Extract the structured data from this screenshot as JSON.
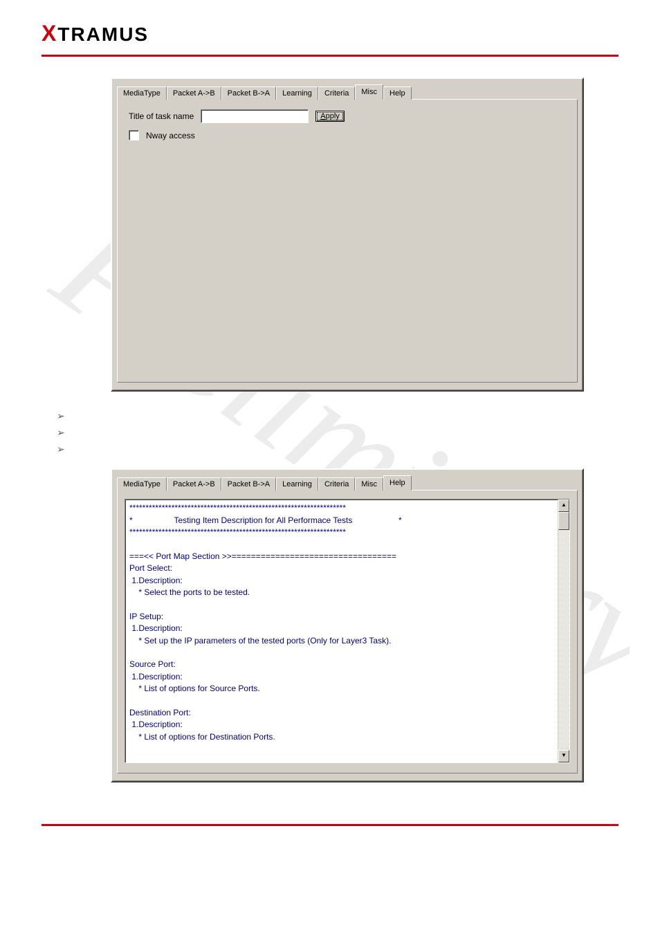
{
  "brand": {
    "prefix": "X",
    "rest": "TRAMUS"
  },
  "tabstrip": {
    "tabs": [
      {
        "label": "MediaType"
      },
      {
        "label": "Packet A->B"
      },
      {
        "label": "Packet B->A"
      },
      {
        "label": "Learning"
      },
      {
        "label": "Criteria"
      },
      {
        "label": "Misc"
      },
      {
        "label": "Help"
      }
    ]
  },
  "misc_panel": {
    "title_label": "Title of task name",
    "title_value": "",
    "apply_label": "Apply",
    "nway_label": "Nway access"
  },
  "help_panel": {
    "text": "*******************************************************************\n*                  Testing Item Description for All Performace Tests                    *\n*******************************************************************\n\n===<< Port Map Section >>==================================\nPort Select:\n 1.Description:\n    * Select the ports to be tested.\n\nIP Setup:\n 1.Description:\n    * Set up the IP parameters of the tested ports (Only for Layer3 Task).\n\nSource Port:\n 1.Description:\n    * List of options for Source Ports.\n\nDestination Port:\n 1.Description:\n    * List of options for Destination Ports."
  },
  "scroll": {
    "up": "▲",
    "down": "▼"
  }
}
